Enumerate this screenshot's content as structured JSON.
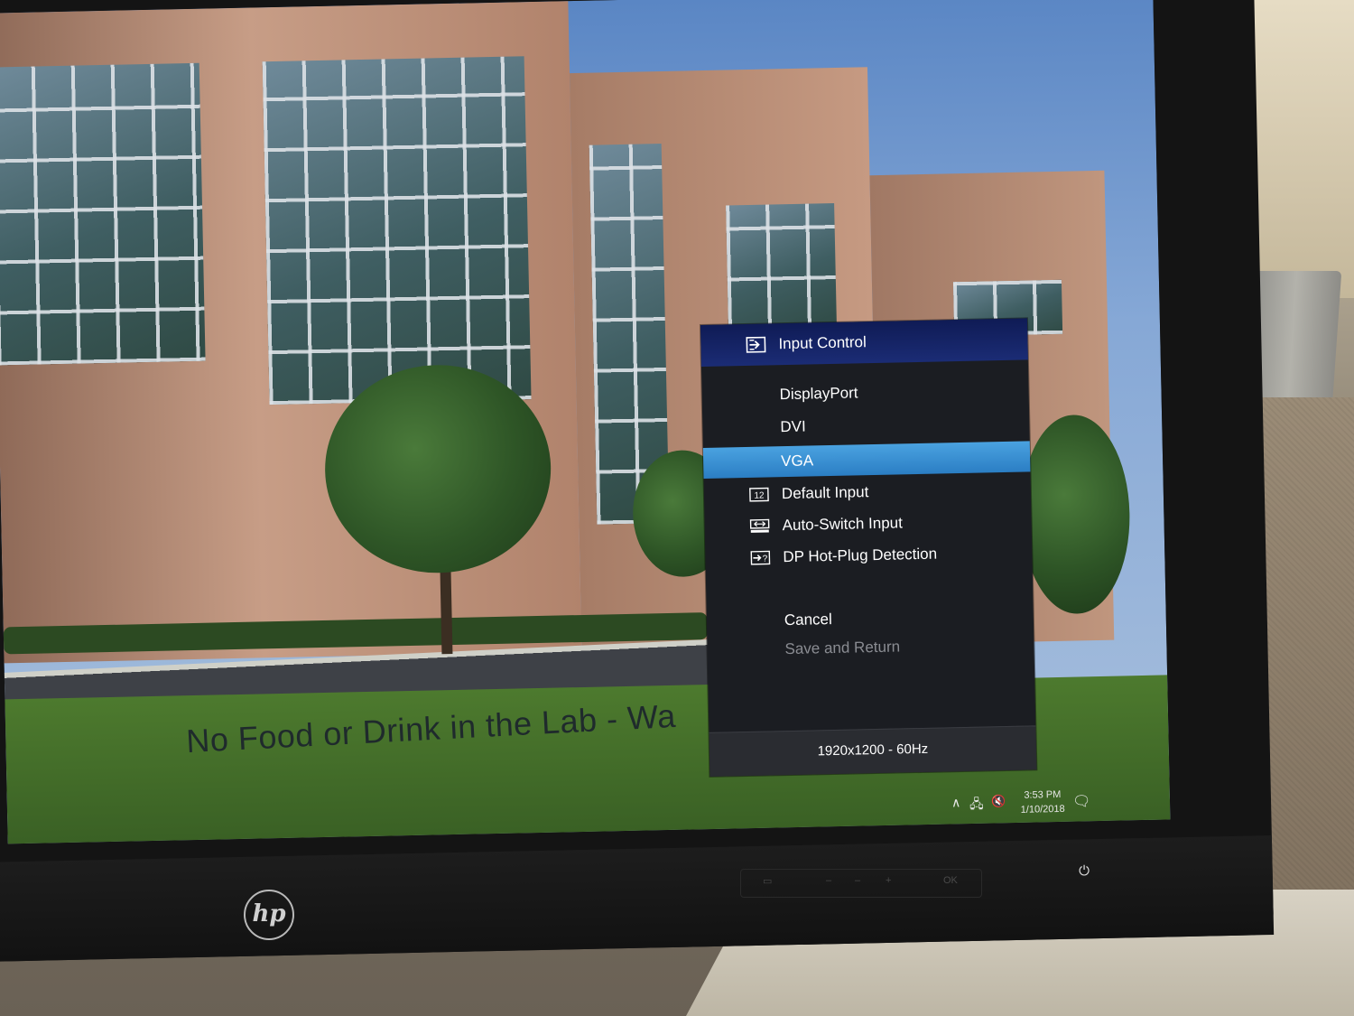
{
  "osd": {
    "title": "Input Control",
    "title_icon": "input-arrow-icon",
    "items": [
      {
        "label": "DisplayPort",
        "icon": "",
        "selected": false,
        "disabled": false
      },
      {
        "label": "DVI",
        "icon": "",
        "selected": false,
        "disabled": false
      },
      {
        "label": "VGA",
        "icon": "",
        "selected": true,
        "disabled": false
      },
      {
        "label": "Default Input",
        "icon": "default-input-icon",
        "selected": false,
        "disabled": false
      },
      {
        "label": "Auto-Switch Input",
        "icon": "auto-switch-icon",
        "selected": false,
        "disabled": false
      },
      {
        "label": "DP Hot-Plug Detection",
        "icon": "hot-plug-icon",
        "selected": false,
        "disabled": false
      },
      {
        "label": "Cancel",
        "icon": "",
        "selected": false,
        "disabled": false
      },
      {
        "label": "Save and Return",
        "icon": "",
        "selected": false,
        "disabled": true
      }
    ],
    "resolution": "1920x1200 - 60Hz",
    "accent_colors": {
      "header": "#1b2c75",
      "selected": "#3a8fd2"
    }
  },
  "wallpaper": {
    "caption": "No Food or Drink in the Lab - Wa"
  },
  "taskbar": {
    "time": "3:53 PM",
    "date": "1/10/2018",
    "tray_icons": [
      "chevron-up-icon",
      "network-icon",
      "volume-muted-icon",
      "notification-icon"
    ]
  },
  "bezel": {
    "buttons": [
      "menu-button",
      "minus-button",
      "plus-button",
      "ok-button",
      "power-button"
    ],
    "labels": {
      "ok": "OK"
    }
  }
}
